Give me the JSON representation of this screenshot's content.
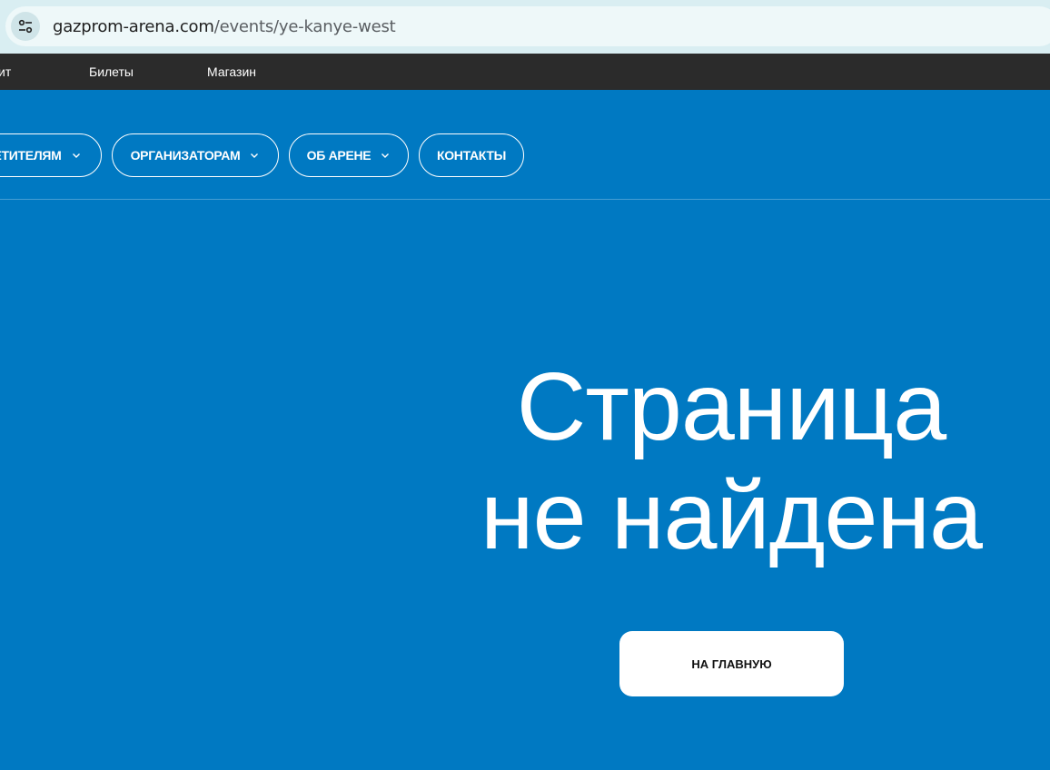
{
  "browser": {
    "url_host": "gazprom-arena.com",
    "url_path": "/events/ye-kanye-west",
    "site_info_icon": "tune-icon"
  },
  "top_nav": {
    "items": [
      {
        "label": "ит"
      },
      {
        "label": "Билеты"
      },
      {
        "label": "Магазин"
      }
    ]
  },
  "main_nav": {
    "items": [
      {
        "label": "ЕТИТЕЛЯМ",
        "has_dropdown": true
      },
      {
        "label": "ОРГАНИЗАТОРАМ",
        "has_dropdown": true
      },
      {
        "label": "ОБ АРЕНЕ",
        "has_dropdown": true
      },
      {
        "label": "КОНТАКТЫ",
        "has_dropdown": false
      }
    ]
  },
  "error": {
    "line1": "Страница",
    "line2": "не найдена",
    "home_button": "НА ГЛАВНУЮ"
  },
  "colors": {
    "background": "#0079c2",
    "top_nav": "#2b2b2b",
    "browser_bar": "#d9eef2"
  }
}
